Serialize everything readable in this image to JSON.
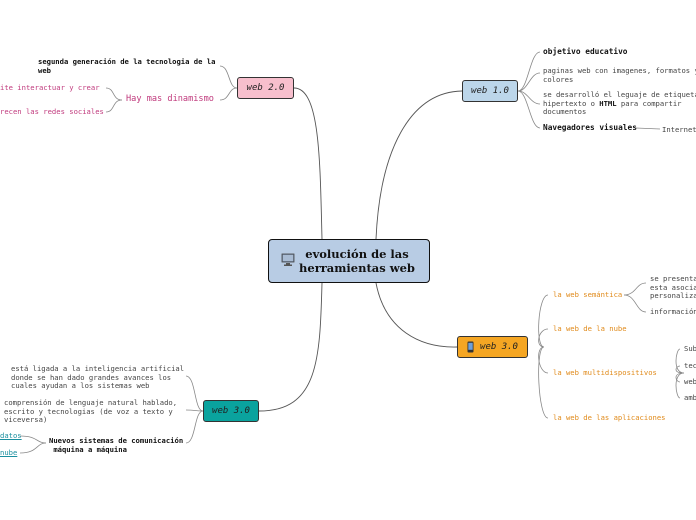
{
  "central": {
    "title_line1": "evolución de las",
    "title_line2": "herramientas web",
    "icon": "computer-icon"
  },
  "web1": {
    "label": "web 1.0",
    "color": "#bcd6ea",
    "items": {
      "objective": "objetivo educativo",
      "pages_l1": "paginas web con imagenes, formatos y",
      "pages_l2": "colores",
      "html_l1": "se desarrolló el leguaje de etiquetas",
      "html_l2a": "hipertexto o ",
      "html_l2b": "HTML",
      "html_l2c": " para compartir",
      "html_l3": "documentos",
      "browsers": "Navegadores visuales",
      "internet": "Internet"
    }
  },
  "web2": {
    "label": "web 2.0",
    "color": "#f7bfcd",
    "items": {
      "second_gen_l1": "segunda generación de la tecnologia de la",
      "second_gen_l2": "web",
      "dynamism": "Hay mas dinamismo",
      "interact": "ite interactuar y crear",
      "social": "recen las redes sociales"
    }
  },
  "web3_orange": {
    "label": "web 3.0",
    "color": "#f5a623",
    "icon": "phone-icon",
    "items": {
      "semantic": "la web semántica",
      "sem_l1": "se presenta",
      "sem_l2": "esta asocia",
      "sem_l3": "personaliza",
      "info": "información",
      "cloud": "la web de la nube",
      "multi": "la web multidispositivos",
      "m1": "Sub",
      "m2": "tec",
      "m3": "web",
      "m4": "amb",
      "apps": "la web de las aplicaciones"
    }
  },
  "web3_teal": {
    "label": "web 3.0",
    "color": "#0aa39e",
    "items": {
      "ai_l1": "está ligada a la inteligencia artificial",
      "ai_l2": "donde se han dado grandes avances los",
      "ai_l3": "cuales ayudan a los sistemas web",
      "nl_l1": "comprensión de lenguaje natural hablado,",
      "nl_l2": "escrito y tecnologias (de voz a texto y",
      "nl_l3": "viceversa)",
      "data": "datos",
      "cloud": "nube",
      "m2m_l1": "Nuevos sistemas de comunicación",
      "m2m_l2": "máquina a máquina"
    }
  }
}
